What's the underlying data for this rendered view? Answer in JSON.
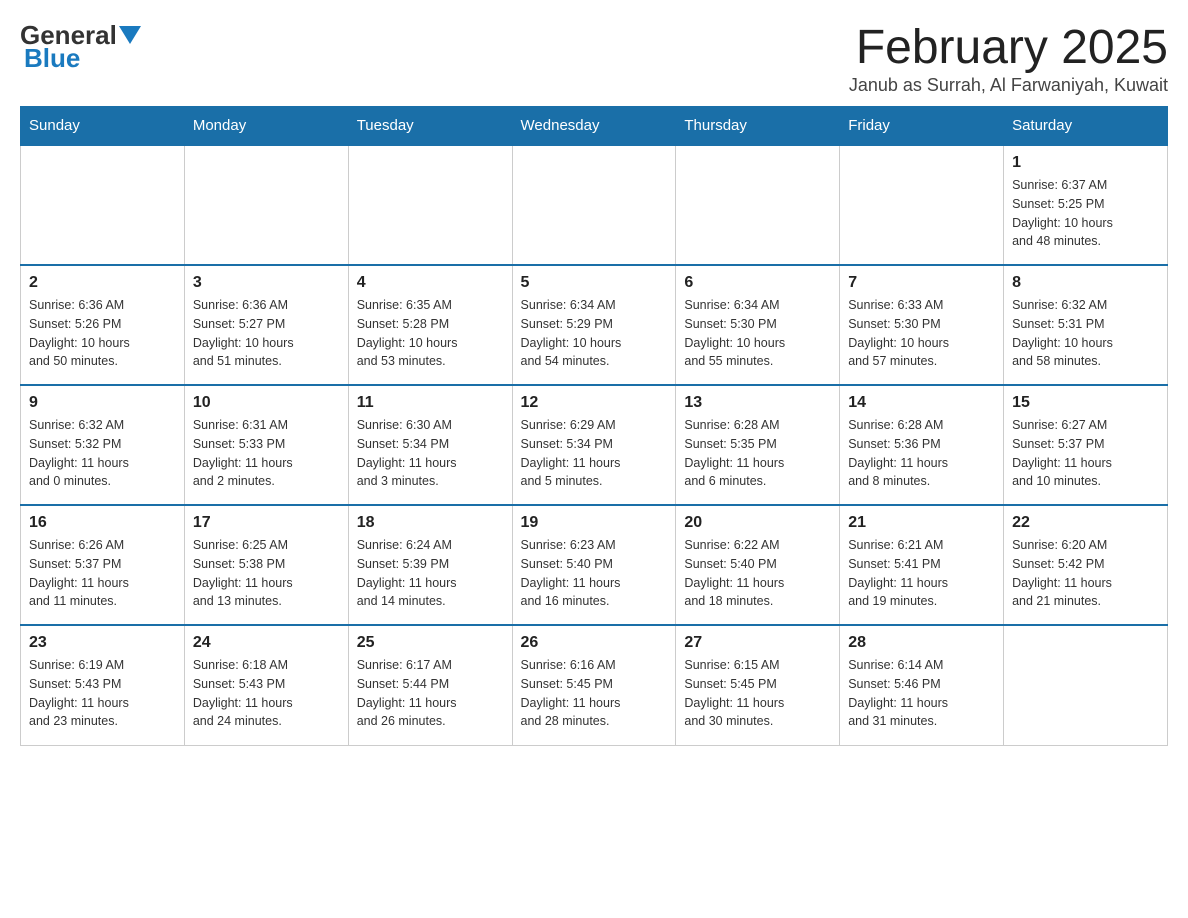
{
  "header": {
    "logo_general": "General",
    "logo_blue": "Blue",
    "month_title": "February 2025",
    "location": "Janub as Surrah, Al Farwaniyah, Kuwait"
  },
  "weekdays": [
    "Sunday",
    "Monday",
    "Tuesday",
    "Wednesday",
    "Thursday",
    "Friday",
    "Saturday"
  ],
  "weeks": [
    [
      {
        "day": "",
        "info": ""
      },
      {
        "day": "",
        "info": ""
      },
      {
        "day": "",
        "info": ""
      },
      {
        "day": "",
        "info": ""
      },
      {
        "day": "",
        "info": ""
      },
      {
        "day": "",
        "info": ""
      },
      {
        "day": "1",
        "info": "Sunrise: 6:37 AM\nSunset: 5:25 PM\nDaylight: 10 hours\nand 48 minutes."
      }
    ],
    [
      {
        "day": "2",
        "info": "Sunrise: 6:36 AM\nSunset: 5:26 PM\nDaylight: 10 hours\nand 50 minutes."
      },
      {
        "day": "3",
        "info": "Sunrise: 6:36 AM\nSunset: 5:27 PM\nDaylight: 10 hours\nand 51 minutes."
      },
      {
        "day": "4",
        "info": "Sunrise: 6:35 AM\nSunset: 5:28 PM\nDaylight: 10 hours\nand 53 minutes."
      },
      {
        "day": "5",
        "info": "Sunrise: 6:34 AM\nSunset: 5:29 PM\nDaylight: 10 hours\nand 54 minutes."
      },
      {
        "day": "6",
        "info": "Sunrise: 6:34 AM\nSunset: 5:30 PM\nDaylight: 10 hours\nand 55 minutes."
      },
      {
        "day": "7",
        "info": "Sunrise: 6:33 AM\nSunset: 5:30 PM\nDaylight: 10 hours\nand 57 minutes."
      },
      {
        "day": "8",
        "info": "Sunrise: 6:32 AM\nSunset: 5:31 PM\nDaylight: 10 hours\nand 58 minutes."
      }
    ],
    [
      {
        "day": "9",
        "info": "Sunrise: 6:32 AM\nSunset: 5:32 PM\nDaylight: 11 hours\nand 0 minutes."
      },
      {
        "day": "10",
        "info": "Sunrise: 6:31 AM\nSunset: 5:33 PM\nDaylight: 11 hours\nand 2 minutes."
      },
      {
        "day": "11",
        "info": "Sunrise: 6:30 AM\nSunset: 5:34 PM\nDaylight: 11 hours\nand 3 minutes."
      },
      {
        "day": "12",
        "info": "Sunrise: 6:29 AM\nSunset: 5:34 PM\nDaylight: 11 hours\nand 5 minutes."
      },
      {
        "day": "13",
        "info": "Sunrise: 6:28 AM\nSunset: 5:35 PM\nDaylight: 11 hours\nand 6 minutes."
      },
      {
        "day": "14",
        "info": "Sunrise: 6:28 AM\nSunset: 5:36 PM\nDaylight: 11 hours\nand 8 minutes."
      },
      {
        "day": "15",
        "info": "Sunrise: 6:27 AM\nSunset: 5:37 PM\nDaylight: 11 hours\nand 10 minutes."
      }
    ],
    [
      {
        "day": "16",
        "info": "Sunrise: 6:26 AM\nSunset: 5:37 PM\nDaylight: 11 hours\nand 11 minutes."
      },
      {
        "day": "17",
        "info": "Sunrise: 6:25 AM\nSunset: 5:38 PM\nDaylight: 11 hours\nand 13 minutes."
      },
      {
        "day": "18",
        "info": "Sunrise: 6:24 AM\nSunset: 5:39 PM\nDaylight: 11 hours\nand 14 minutes."
      },
      {
        "day": "19",
        "info": "Sunrise: 6:23 AM\nSunset: 5:40 PM\nDaylight: 11 hours\nand 16 minutes."
      },
      {
        "day": "20",
        "info": "Sunrise: 6:22 AM\nSunset: 5:40 PM\nDaylight: 11 hours\nand 18 minutes."
      },
      {
        "day": "21",
        "info": "Sunrise: 6:21 AM\nSunset: 5:41 PM\nDaylight: 11 hours\nand 19 minutes."
      },
      {
        "day": "22",
        "info": "Sunrise: 6:20 AM\nSunset: 5:42 PM\nDaylight: 11 hours\nand 21 minutes."
      }
    ],
    [
      {
        "day": "23",
        "info": "Sunrise: 6:19 AM\nSunset: 5:43 PM\nDaylight: 11 hours\nand 23 minutes."
      },
      {
        "day": "24",
        "info": "Sunrise: 6:18 AM\nSunset: 5:43 PM\nDaylight: 11 hours\nand 24 minutes."
      },
      {
        "day": "25",
        "info": "Sunrise: 6:17 AM\nSunset: 5:44 PM\nDaylight: 11 hours\nand 26 minutes."
      },
      {
        "day": "26",
        "info": "Sunrise: 6:16 AM\nSunset: 5:45 PM\nDaylight: 11 hours\nand 28 minutes."
      },
      {
        "day": "27",
        "info": "Sunrise: 6:15 AM\nSunset: 5:45 PM\nDaylight: 11 hours\nand 30 minutes."
      },
      {
        "day": "28",
        "info": "Sunrise: 6:14 AM\nSunset: 5:46 PM\nDaylight: 11 hours\nand 31 minutes."
      },
      {
        "day": "",
        "info": ""
      }
    ]
  ]
}
